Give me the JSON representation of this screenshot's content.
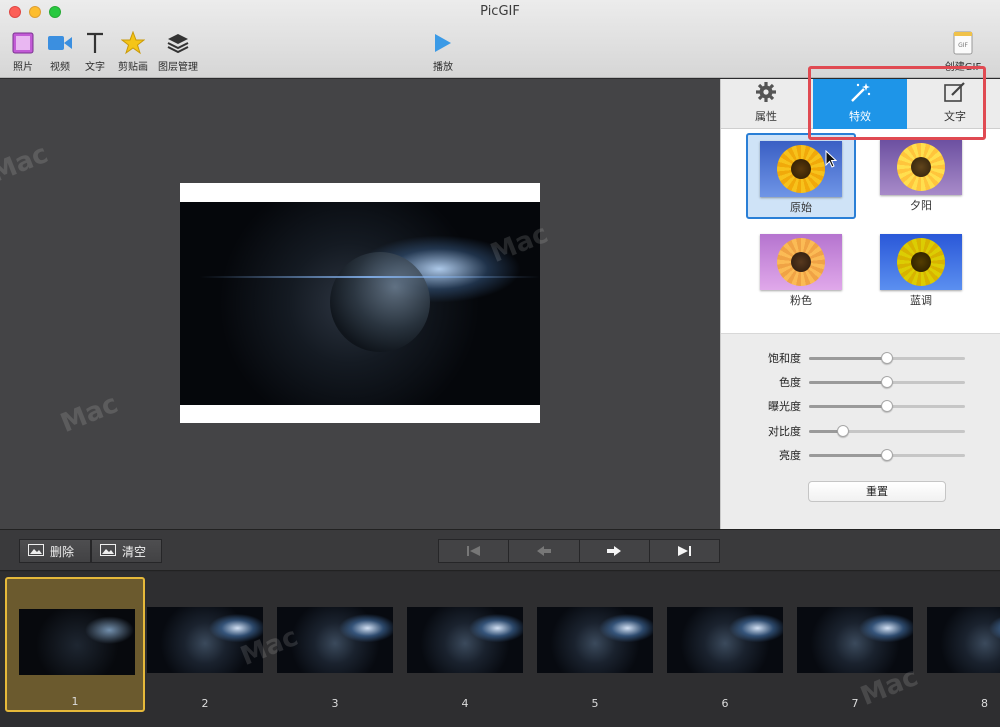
{
  "window": {
    "title": "PicGIF"
  },
  "toolbar": {
    "photos": "照片",
    "video": "视频",
    "text": "文字",
    "clipart": "剪贴画",
    "layers": "图层管理",
    "play": "播放",
    "create_gif": "创建GIF",
    "create_gif_icon_text": "GIF"
  },
  "panel_tabs": {
    "properties": "属性",
    "effects": "特效",
    "text": "文字",
    "active": "effects"
  },
  "effects": {
    "items": [
      {
        "label": "原始",
        "selected": true
      },
      {
        "label": "夕阳",
        "selected": false
      },
      {
        "label": "粉色",
        "selected": false
      },
      {
        "label": "蓝调",
        "selected": false
      }
    ]
  },
  "adjustments": {
    "sliders": [
      {
        "label": "饱和度",
        "value": 0.5
      },
      {
        "label": "色度",
        "value": 0.5
      },
      {
        "label": "曝光度",
        "value": 0.5
      },
      {
        "label": "对比度",
        "value": 0.22
      },
      {
        "label": "亮度",
        "value": 0.5
      }
    ],
    "reset_label": "重置"
  },
  "controls": {
    "delete_label": "删除",
    "clear_label": "清空"
  },
  "filmstrip": {
    "frames": [
      "1",
      "2",
      "3",
      "4",
      "5",
      "6",
      "7",
      "8"
    ],
    "selected": "1"
  },
  "colors": {
    "accent": "#1e95e8",
    "highlight_box": "#e04a52",
    "selected_frame_border": "#e6b93a"
  }
}
